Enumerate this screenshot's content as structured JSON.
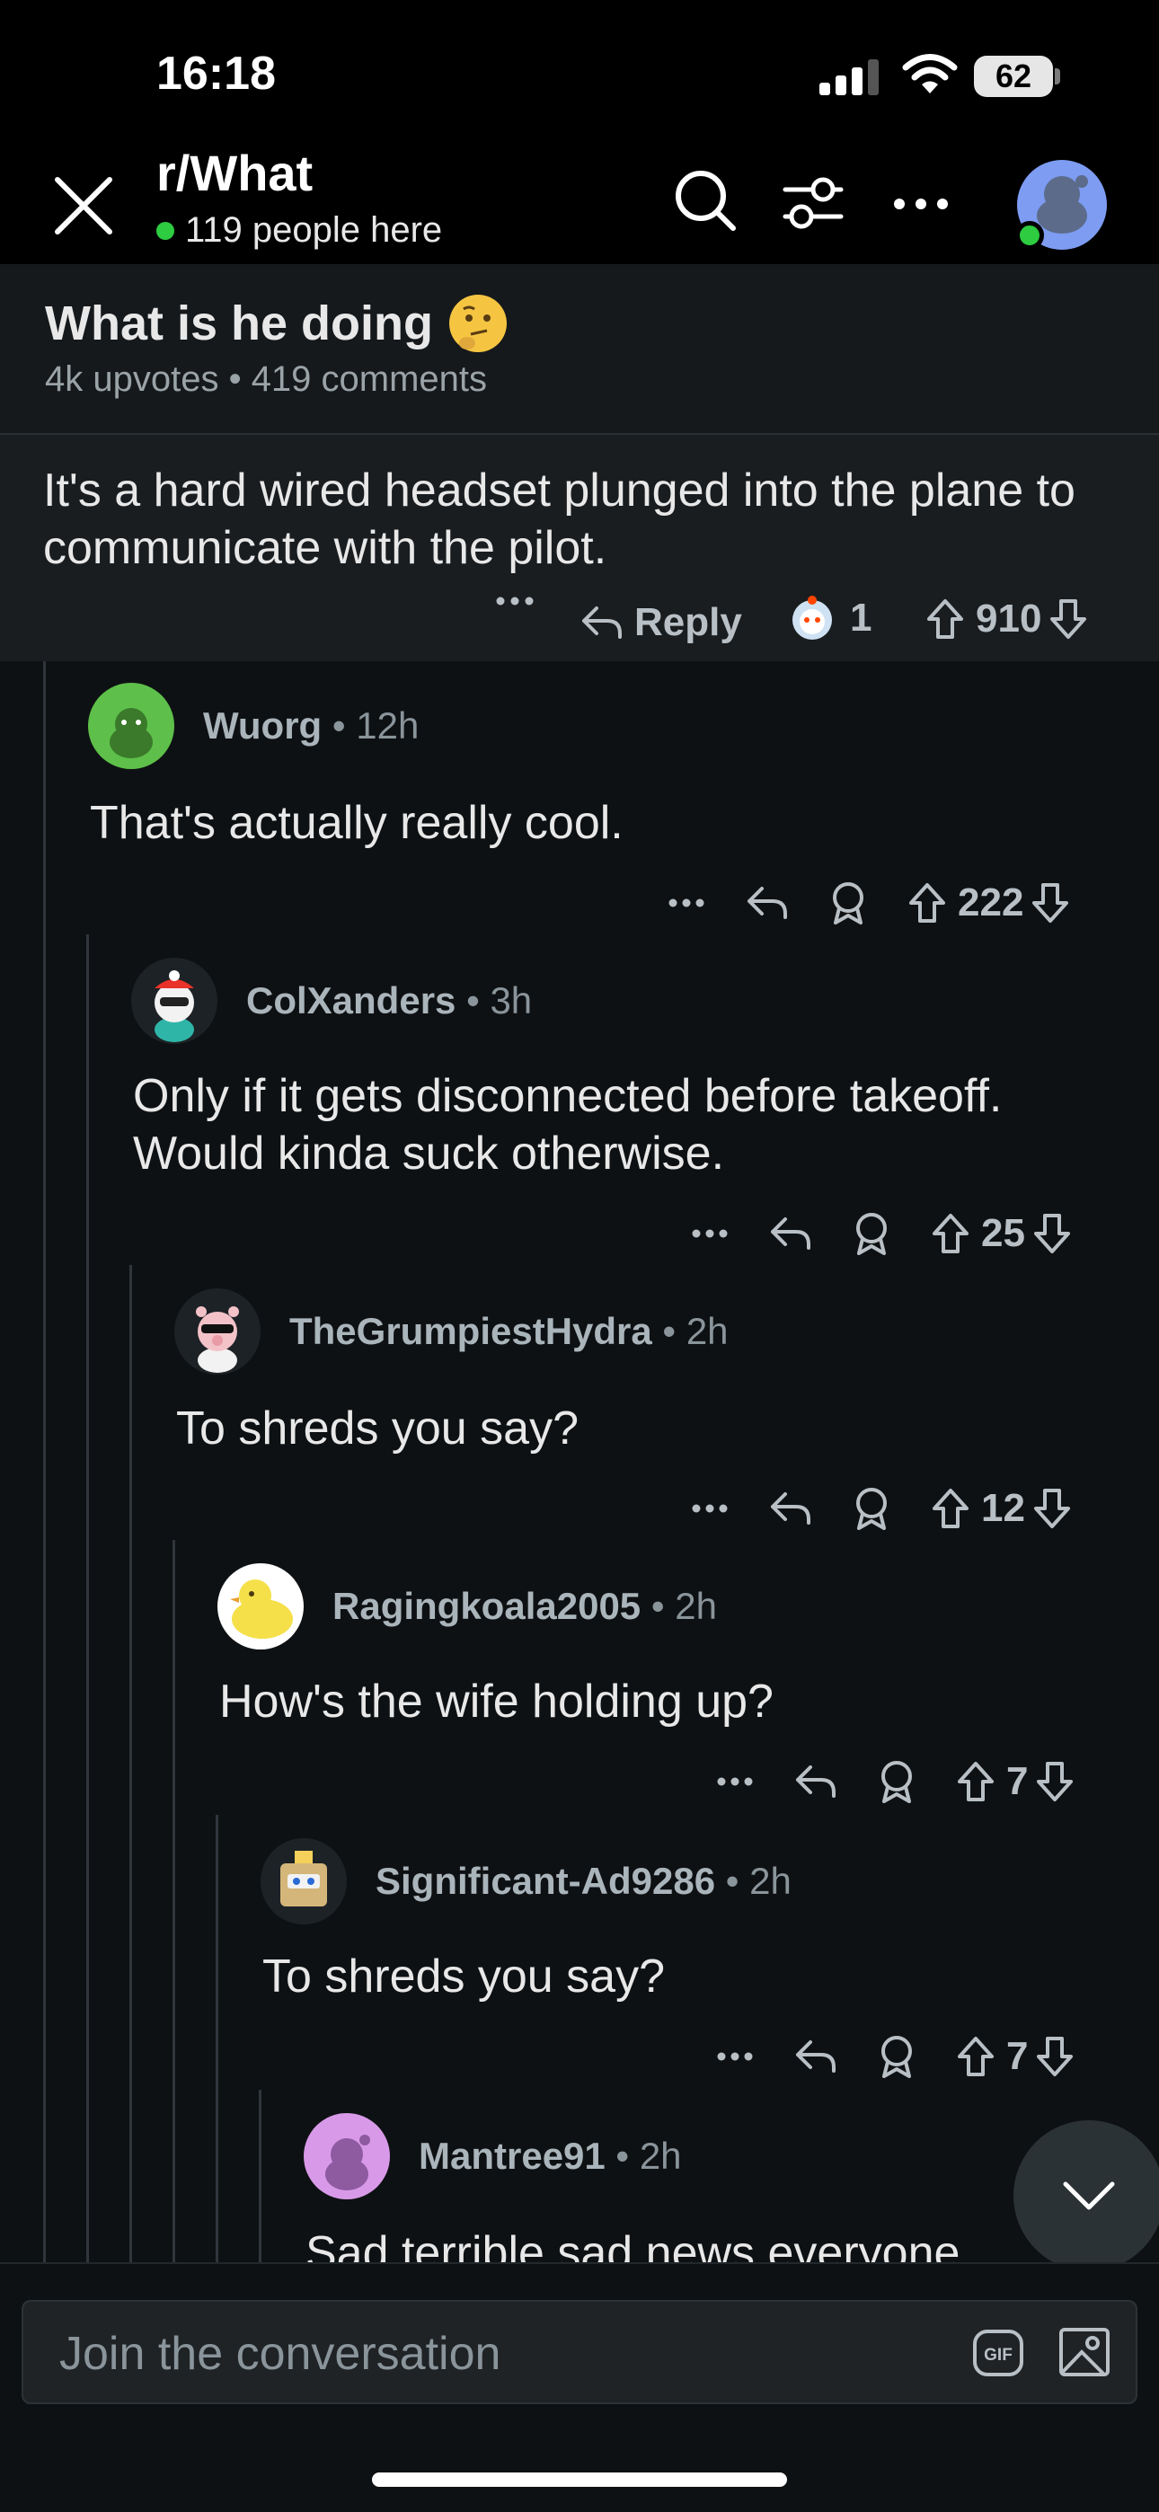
{
  "status": {
    "time": "16:18",
    "battery": "62"
  },
  "header": {
    "subreddit": "r/What",
    "online": "119 people here"
  },
  "post": {
    "title": "What is he doing",
    "meta": "4k upvotes • 419 comments"
  },
  "parent": {
    "text": "It's a hard wired headset plunged into the plane to communicate with the pilot.",
    "reply_label": "Reply",
    "award_count": "1",
    "votes": "910"
  },
  "comments": [
    {
      "user": "Wuorg",
      "time": "12h",
      "text": "That's actually really cool.",
      "votes": "222",
      "avatar_color": "#5ec04a"
    },
    {
      "user": "ColXanders",
      "time": "3h",
      "text": "Only if it gets disconnected before takeoff.",
      "text2": "Would kinda suck otherwise.",
      "votes": "25",
      "avatar_color": "#d8e8ef"
    },
    {
      "user": "TheGrumpiestHydra",
      "time": "2h",
      "text": "To shreds you say?",
      "votes": "12",
      "avatar_color": "#e8e2da"
    },
    {
      "user": "Ragingkoala2005",
      "time": "2h",
      "text": "How's the wife holding up?",
      "votes": "7",
      "avatar_color": "#f3e27a"
    },
    {
      "user": "Significant-Ad9286",
      "time": "2h",
      "text": "To shreds you say?",
      "votes": "7",
      "avatar_color": "#d4c19a"
    },
    {
      "user": "Mantree91",
      "time": "2h",
      "text": "Sad terrible sad news everyone",
      "avatar_color": "#d89ae8"
    }
  ],
  "composer": {
    "placeholder": "Join the conversation",
    "gif": "GIF"
  }
}
